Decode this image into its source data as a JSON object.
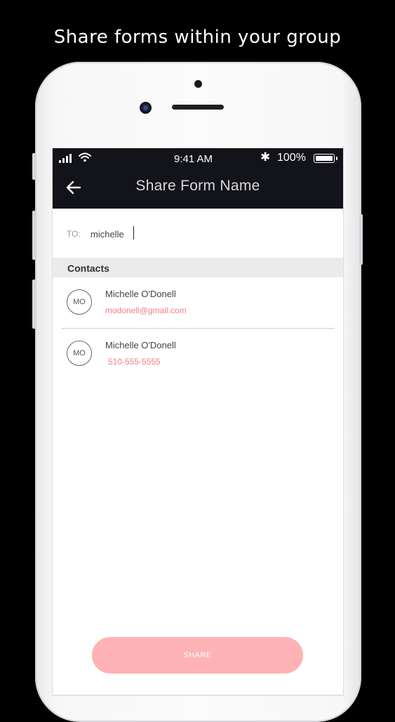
{
  "caption": "Share forms within your group",
  "status_bar": {
    "time": "9:41 AM",
    "battery": "100%",
    "icons": [
      "signal-icon",
      "wifi-icon",
      "bluetooth-icon",
      "battery-icon"
    ]
  },
  "header": {
    "title": "Share Form Name",
    "back_icon": "arrow-left-icon"
  },
  "to_field": {
    "label": "TO:",
    "value": "michelle"
  },
  "contacts_section": {
    "label": "Contacts",
    "items": [
      {
        "initials": "MO",
        "name": "Michelle O'Donell",
        "detail": "modonell@gmail.com"
      },
      {
        "initials": "MO",
        "name": "Michelle O'Donell",
        "detail": "510-555-5555"
      }
    ]
  },
  "share_button": {
    "label": "SHARE"
  },
  "colors": {
    "accent": "#fdb3b5",
    "detail_text": "#f07e82",
    "header_bg": "#131419"
  }
}
